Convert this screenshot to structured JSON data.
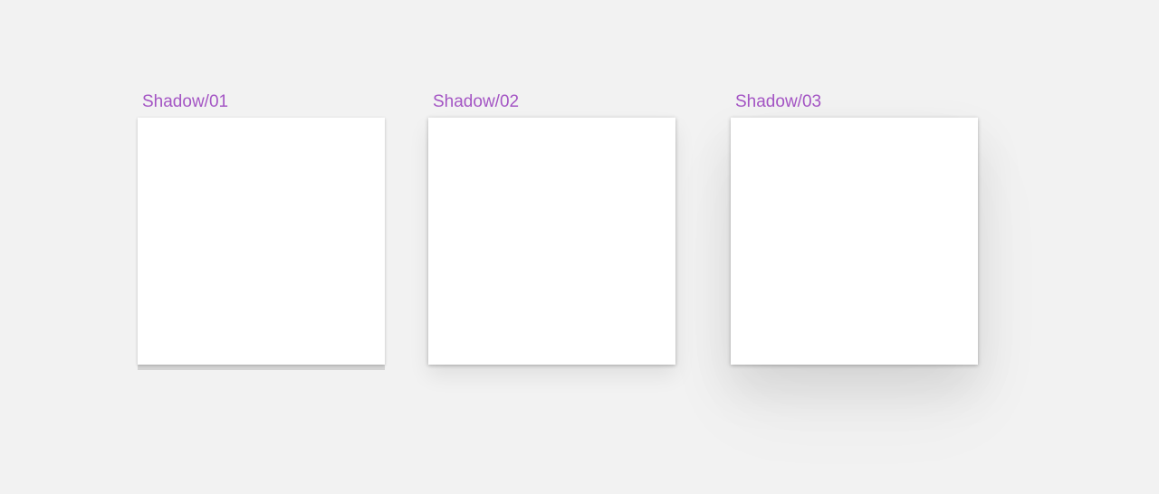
{
  "canvas": {
    "background": "#f2f2f2",
    "label_color": "#a455c4"
  },
  "frames": [
    {
      "label": "Shadow/01"
    },
    {
      "label": "Shadow/02"
    },
    {
      "label": "Shadow/03"
    }
  ]
}
